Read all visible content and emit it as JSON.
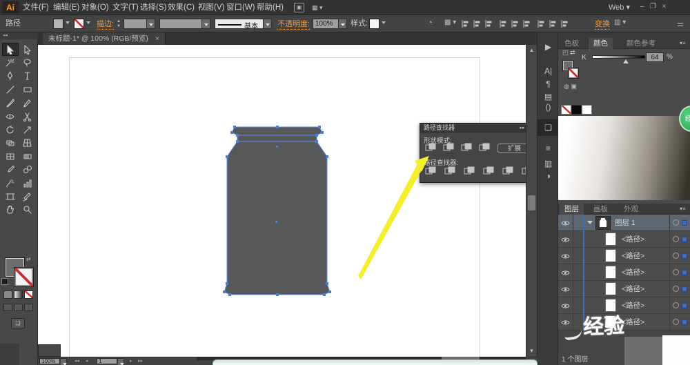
{
  "window": {
    "logo": "Ai",
    "menus": [
      "文件(F)",
      "编辑(E)",
      "对象(O)",
      "文字(T)",
      "选择(S)",
      "效果(C)",
      "视图(V)",
      "窗口(W)",
      "帮助(H)"
    ],
    "workspace": "Web",
    "minimize": "–",
    "restore": "回",
    "close": "×"
  },
  "controlbar": {
    "selection_label": "路径",
    "stroke_label": "描边:",
    "brush_definition": "基本",
    "opacity_label": "不透明度:",
    "opacity_value": "100%",
    "style_label": "样式:",
    "transform_label": "变换"
  },
  "doc_tab": {
    "title": "未标题-1* @ 100% (RGB/预览)",
    "close": "×"
  },
  "tools": [
    "selection",
    "direct-selection",
    "magic-wand",
    "lasso",
    "pen",
    "type",
    "line-segment",
    "rectangle",
    "paintbrush",
    "pencil",
    "width",
    "scissors",
    "rotate",
    "scale",
    "shape-builder",
    "perspective-grid",
    "mesh",
    "gradient",
    "eyedropper",
    "blend",
    "symbol-sprayer",
    "column-graph",
    "artboard",
    "slice",
    "hand",
    "zoom"
  ],
  "pathfinder": {
    "title": "路径查找器",
    "shape_modes_label": "形状模式:",
    "expand_button": "扩展",
    "pathfinder_label": "路径查找器:",
    "shape_mode_icons": [
      "unite",
      "minus-front",
      "intersect",
      "exclude"
    ],
    "pathfinder_icons": [
      "divide",
      "trim",
      "merge",
      "crop",
      "outline",
      "minus-back"
    ]
  },
  "color_panel": {
    "tabs": [
      "色板",
      "颜色",
      "颜色参考"
    ],
    "active_tab": "颜色",
    "k_label": "K",
    "k_value": "64",
    "percent": "%"
  },
  "layers_panel": {
    "tabs": [
      "图层",
      "画板",
      "外观"
    ],
    "active_tab": "图层",
    "layer_name": "图层 1",
    "path_rows": [
      "<路径>",
      "<路径>",
      "<路径>",
      "<路径>",
      "<路径>",
      "<路径>"
    ],
    "status": "1 个图层"
  },
  "statusbar": {
    "zoom": "100%",
    "artboard_number": "1"
  },
  "watermark": {
    "badge": "经验",
    "layers_text": "经验"
  },
  "colors": {
    "accent_orange": "#e89b4a",
    "selection_blue": "#3d6cc0",
    "canvas_shape": "#57585a",
    "arrow_yellow": "#f4ef2d"
  }
}
